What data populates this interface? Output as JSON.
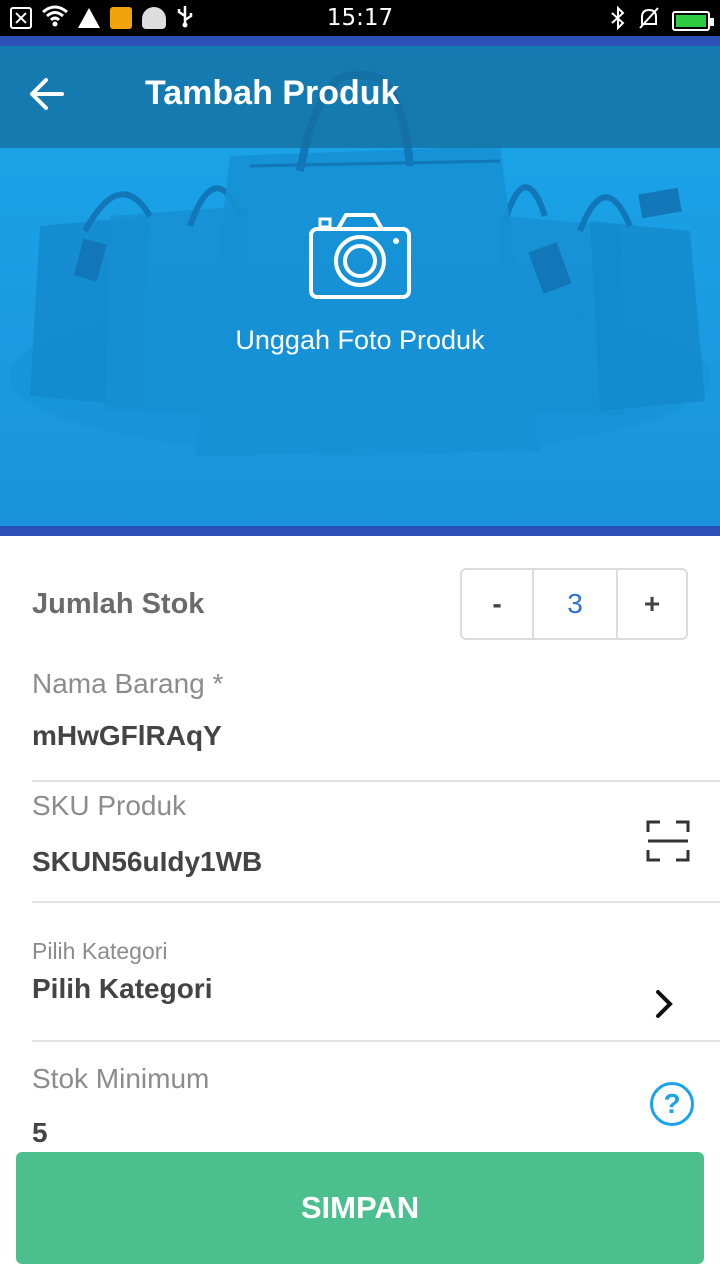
{
  "status_bar": {
    "time": "15:17",
    "left_icons": [
      "notification-box-icon",
      "wifi-icon",
      "warning-icon",
      "tools-icon",
      "android-icon",
      "usb-icon"
    ],
    "right_icons": [
      "bluetooth-icon",
      "silent-icon",
      "battery-icon"
    ]
  },
  "header": {
    "title": "Tambah Produk",
    "back_icon": "arrow-left-icon"
  },
  "hero": {
    "upload_label": "Unggah Foto Produk",
    "camera_icon": "camera-icon"
  },
  "stock": {
    "label": "Jumlah Stok",
    "minus": "-",
    "value": "3",
    "plus": "+"
  },
  "fields": {
    "name": {
      "label": "Nama Barang *",
      "value": "mHwGFlRAqY"
    },
    "sku": {
      "label": "SKU Produk",
      "value": "SKUN56uIdy1WB",
      "icon": "barcode-scan-icon"
    },
    "category": {
      "label": "Pilih Kategori",
      "value": "Pilih Kategori",
      "icon": "chevron-right-icon"
    },
    "min_stock": {
      "label": "Stok Minimum",
      "value": "5",
      "icon": "help-icon",
      "help_glyph": "?"
    }
  },
  "save_button": {
    "label": "SIMPAN"
  },
  "colors": {
    "hero": "#1aa3e8",
    "accent_line": "#2c4fb8",
    "primary_button": "#4cbf8e",
    "stepper_value": "#2f6fd6"
  }
}
